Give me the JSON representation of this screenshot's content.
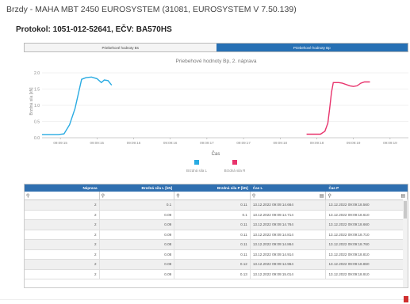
{
  "header": {
    "title": "Brzdy - MAHA MBT 2450 EUROSYSTEM (31081, EUROSYSTEM V 7.50.139)",
    "protocol": "Protokol: 1051-012-52641, EČV: BA570HS"
  },
  "tabs": [
    {
      "label": "Priebehové hodnoty Bs",
      "active": false
    },
    {
      "label": "Priebehové hodnoty Bp",
      "active": true
    }
  ],
  "chart_data": {
    "type": "line",
    "title": "Priebehové hodnoty Bp, 2. náprava",
    "xlabel": "Čas",
    "ylabel": "Brzdná sila [kN]",
    "ylim": [
      0,
      2.0
    ],
    "yticks": [
      "0.0",
      "0.5",
      "1.0",
      "1.5",
      "2.0"
    ],
    "xticks": [
      "09:09:15",
      "09:09:15",
      "09:09:16",
      "09:09:16",
      "09:09:17",
      "09:09:17",
      "09:09:18",
      "09:09:18",
      "09:09:19",
      "09:09:19"
    ],
    "grid": "y",
    "legend_position": "bottom",
    "series": [
      {
        "name": "Brzdná sila L",
        "color": "#29abe2",
        "points": [
          [
            0.0,
            0.1
          ],
          [
            0.45,
            0.1
          ],
          [
            0.6,
            0.12
          ],
          [
            0.75,
            0.4
          ],
          [
            0.9,
            0.9
          ],
          [
            1.0,
            1.4
          ],
          [
            1.08,
            1.8
          ],
          [
            1.2,
            1.85
          ],
          [
            1.35,
            1.87
          ],
          [
            1.5,
            1.82
          ],
          [
            1.62,
            1.7
          ],
          [
            1.7,
            1.78
          ],
          [
            1.8,
            1.76
          ],
          [
            1.9,
            1.62
          ]
        ]
      },
      {
        "name": "Brzdná sila R",
        "color": "#e8336c",
        "points": [
          [
            7.22,
            0.11
          ],
          [
            7.6,
            0.11
          ],
          [
            7.72,
            0.2
          ],
          [
            7.8,
            0.45
          ],
          [
            7.85,
            0.9
          ],
          [
            7.9,
            1.4
          ],
          [
            7.95,
            1.7
          ],
          [
            8.1,
            1.7
          ],
          [
            8.2,
            1.68
          ],
          [
            8.4,
            1.6
          ],
          [
            8.5,
            1.58
          ],
          [
            8.6,
            1.6
          ],
          [
            8.7,
            1.68
          ],
          [
            8.8,
            1.72
          ],
          [
            8.95,
            1.72
          ]
        ]
      }
    ]
  },
  "table": {
    "columns": [
      "Náprava",
      "Brzdná sila L [kN]",
      "Brzdná sila P [kN]",
      "Čas L",
      "Čas P"
    ],
    "rows": [
      [
        "2",
        "0.1",
        "0.11",
        "13.12.2022 09:09:14.664",
        "13.12.2022 09:09:18.560"
      ],
      [
        "2",
        "0.09",
        "0.1",
        "13.12.2022 09:09:14.714",
        "13.12.2022 09:09:18.610"
      ],
      [
        "2",
        "0.09",
        "0.11",
        "13.12.2022 09:09:14.764",
        "13.12.2022 09:09:18.660"
      ],
      [
        "2",
        "0.09",
        "0.11",
        "13.12.2022 09:09:14.814",
        "13.12.2022 09:09:18.710"
      ],
      [
        "2",
        "0.08",
        "0.11",
        "13.12.2022 09:09:14.864",
        "13.12.2022 09:09:18.760"
      ],
      [
        "2",
        "0.08",
        "0.11",
        "13.12.2022 09:09:14.914",
        "13.12.2022 09:09:18.810"
      ],
      [
        "2",
        "0.08",
        "0.12",
        "13.12.2022 09:09:14.964",
        "13.12.2022 09:09:18.860"
      ],
      [
        "2",
        "0.09",
        "0.13",
        "13.12.2022 09:09:15.014",
        "13.12.2022 09:09:18.910"
      ]
    ]
  },
  "icons": {
    "search": "search-icon",
    "calendar": "calendar-icon"
  }
}
